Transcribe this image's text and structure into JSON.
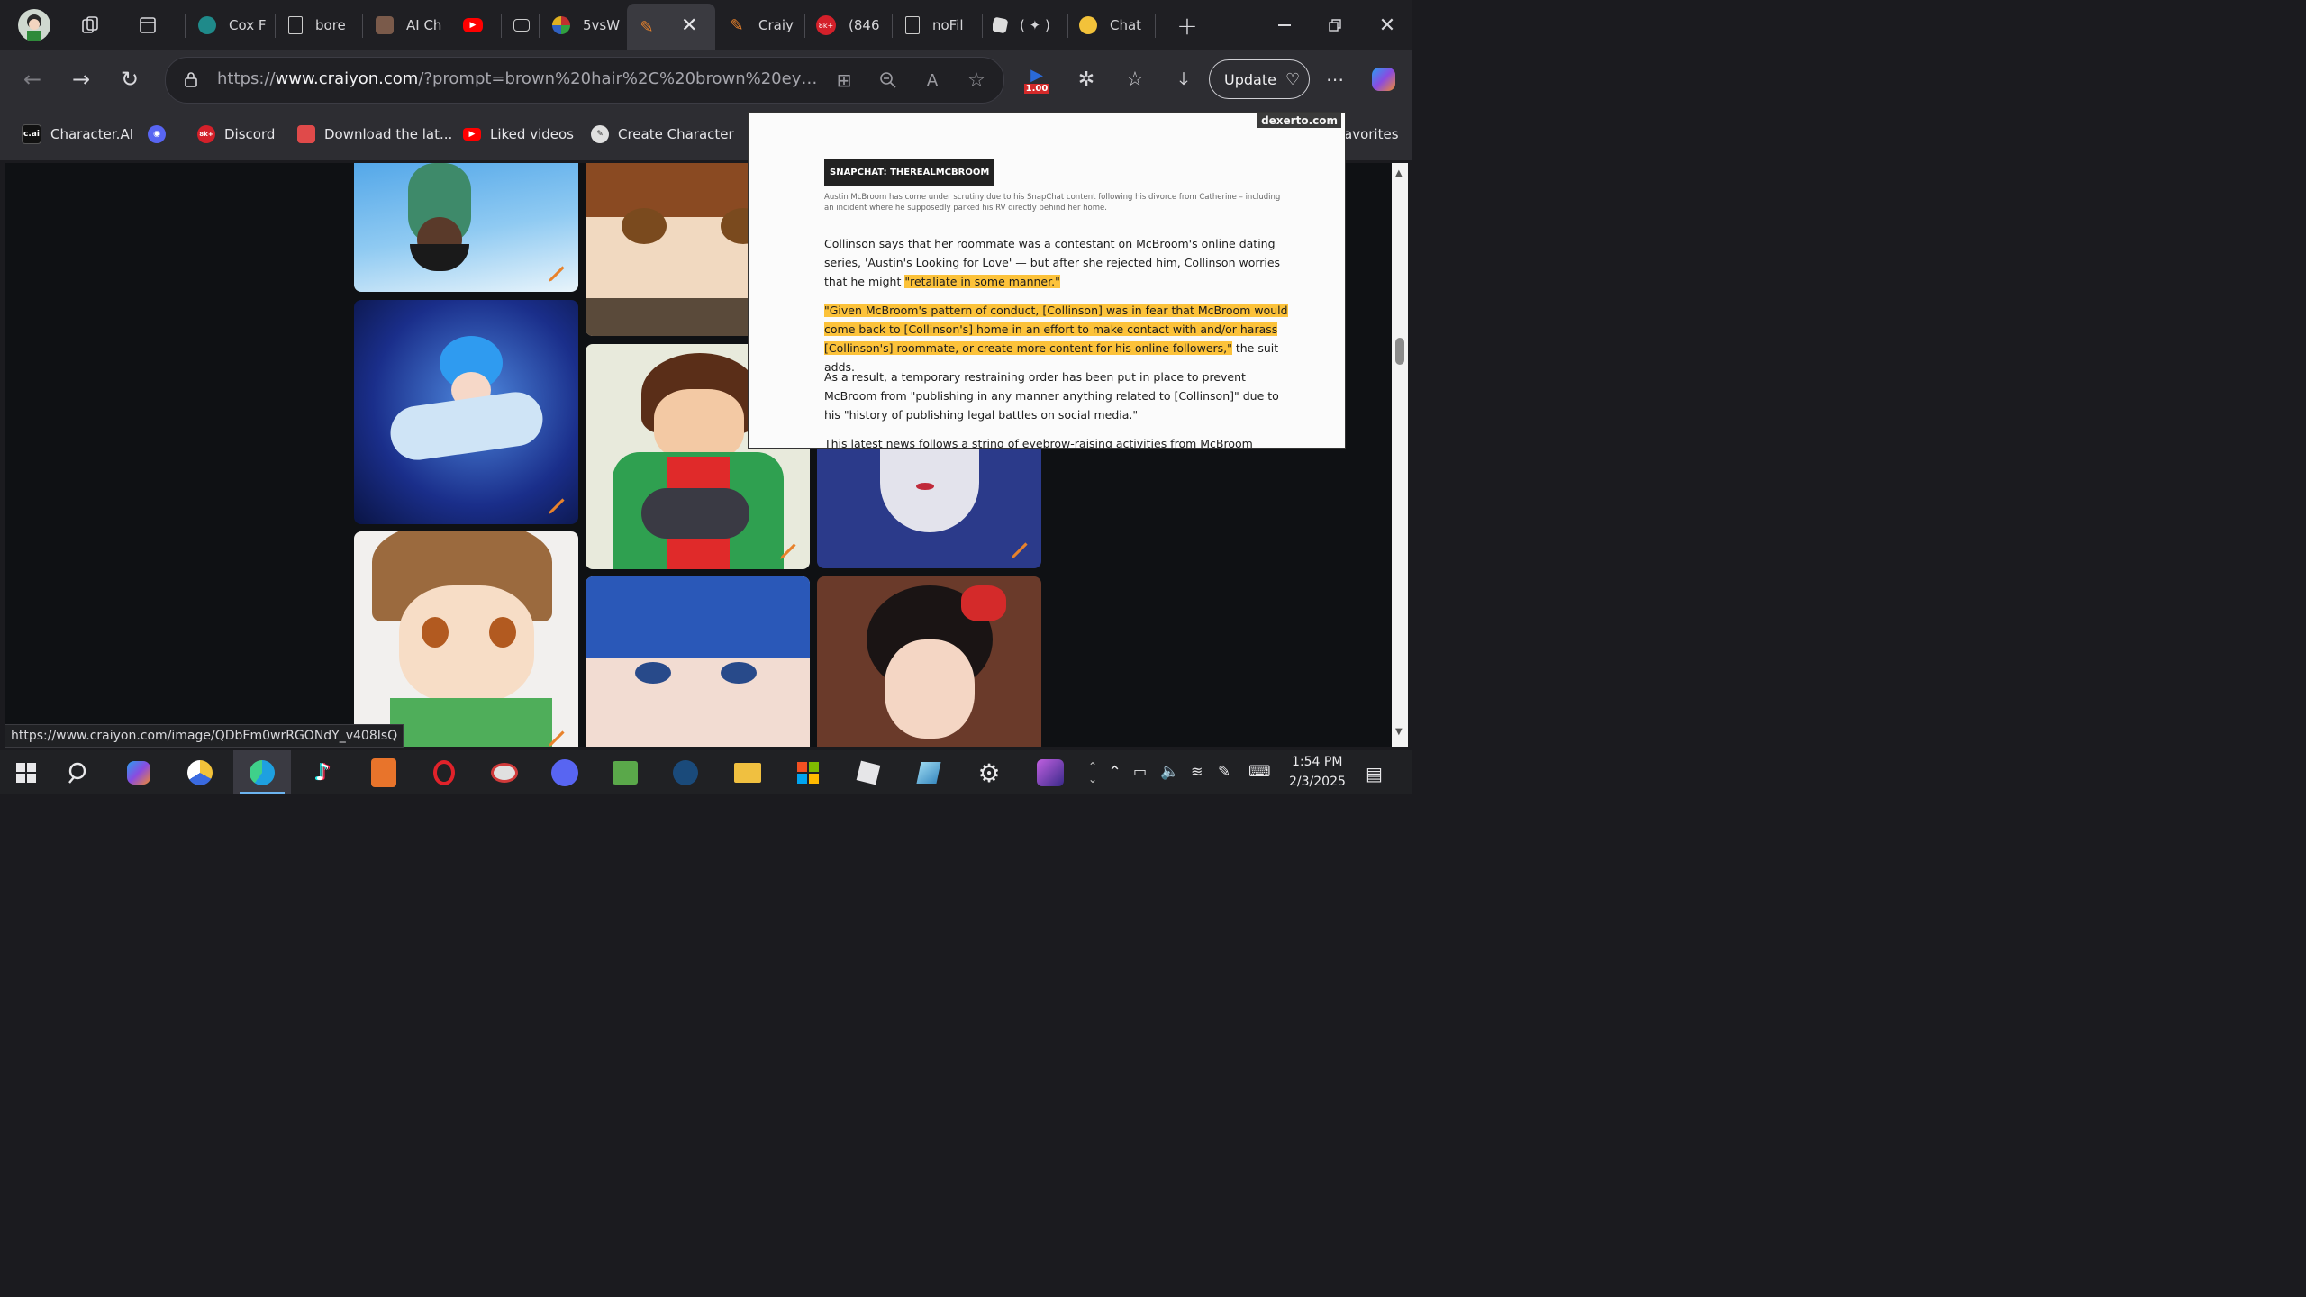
{
  "browser": {
    "tabs": [
      {
        "label": "Cox F",
        "fav_color": "#1f8a8a"
      },
      {
        "label": "bore",
        "fav_color": "#555"
      },
      {
        "label": "AI Ch",
        "fav_color": "#7a5a4a"
      },
      {
        "label": "",
        "fav_color": "#ff0000"
      },
      {
        "label": "",
        "fav_color": "#444"
      },
      {
        "label": "5vsW",
        "fav_color": "#c03030"
      },
      {
        "label": "",
        "fav_color": "#e07020"
      },
      {
        "label": "Craiy",
        "fav_color": "#e07020"
      },
      {
        "label": "(846",
        "fav_color": "#d4202a"
      },
      {
        "label": "noFil",
        "fav_color": "#555"
      },
      {
        "label": "( ✦ )",
        "fav_color": "#ddd"
      },
      {
        "label": "Chat",
        "fav_color": "#f2c23a"
      }
    ],
    "url_prefix": "https://",
    "url_host": "www.craiyon.com",
    "url_path": "/?prompt=brown%20hair%2C%20brown%20eyes%2C%20arm...",
    "rating_badge": "1.00",
    "update_label": "Update",
    "bookmarks": [
      {
        "label": "Character.AI",
        "badge": "c.ai"
      },
      {
        "label": "",
        "badge": ""
      },
      {
        "label": "Discord",
        "badge": "8k+"
      },
      {
        "label": "Download the lat...",
        "badge": ""
      },
      {
        "label": "Liked videos",
        "badge": ""
      },
      {
        "label": "Create Character",
        "badge": ""
      }
    ],
    "other_favorites_fragment": "avorites",
    "status_url": "https://www.craiyon.com/image/QDbFm0wrRGONdY_v408IsQ",
    "tab_badge": "8k+"
  },
  "popup": {
    "source": "dexerto.com",
    "caption_tag": "SNAPCHAT: THEREALMCBROOM",
    "caption_text": "Austin McBroom has come under scrutiny due to his SnapChat content following his divorce from Catherine – including an incident where he supposedly parked his RV directly behind her home.",
    "para1_text": "Collinson says that her roommate was a contestant on McBroom's online dating series, 'Austin's Looking for Love' — but after she rejected him, Collinson worries that he might",
    "para1_highlight": "\"retaliate in some manner.\"",
    "para2_highlight": "\"Given McBroom's pattern of conduct, [Collinson] was in fear that McBroom would come back to [Collinson's] home in an effort to make contact with and/or harass [Collinson's] roommate, or create more content for his online followers,\"",
    "para2_tail": " the suit adds.",
    "para3_text": "As a result, a temporary restraining order has been put in place to prevent McBroom from \"publishing in any manner anything related to [Collinson]\" due to his \"history of publishing legal battles on social media.\"",
    "para4_text": "This latest news follows a string of eyebrow-raising activities from McBroom earlier this year."
  },
  "taskbar": {
    "time": "1:54 PM",
    "date": "2/3/2025"
  },
  "colors": {
    "accent_orange": "#e8822b",
    "highlight": "#fcc23a",
    "edge_blue": "#1ea0e0"
  }
}
